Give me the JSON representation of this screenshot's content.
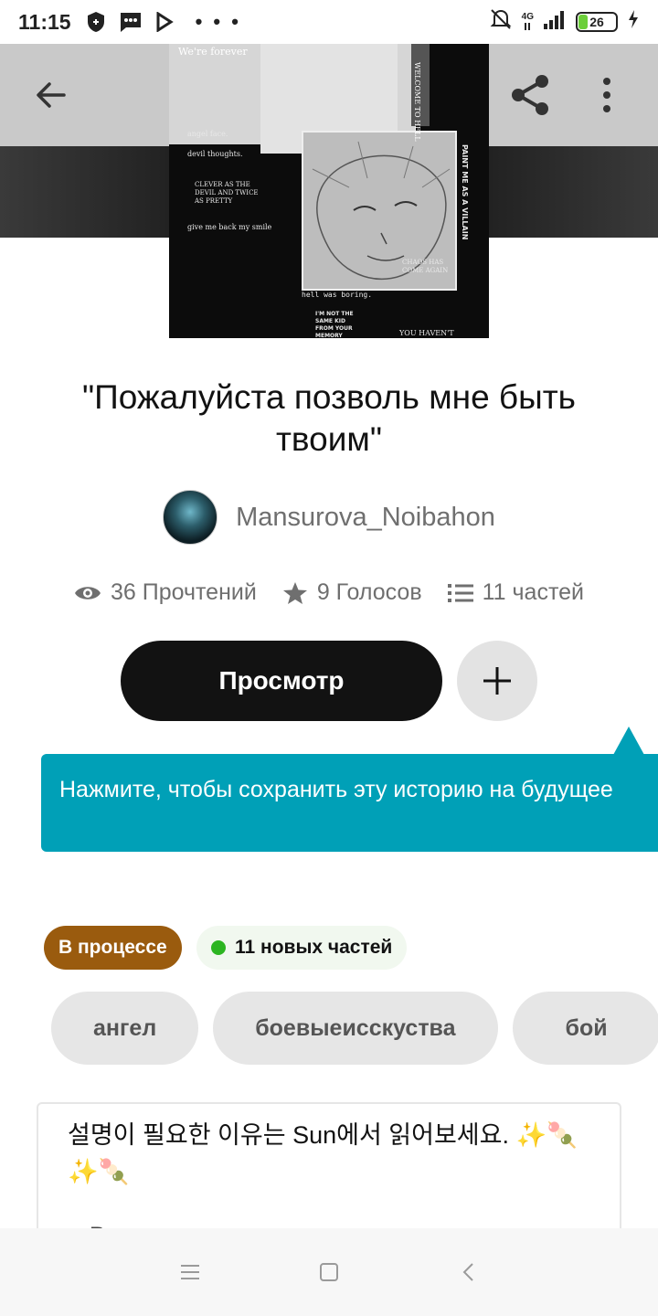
{
  "status_bar": {
    "time": "11:15",
    "network": "4G",
    "battery": "26",
    "battery_level": 0.26,
    "more_indicator": "• • •"
  },
  "toolbar": {
    "back_icon": "arrow-left-icon",
    "share_icon": "share-icon",
    "more_icon": "more-vertical-icon"
  },
  "story": {
    "title": "\"Пожалуйста позволь мне быть твоим\"",
    "author": "Mansurova_Noibahon",
    "reads": "36 Прочтений",
    "votes": "9 Голосов",
    "parts": "11 частей"
  },
  "cover_text": {
    "t1": "We're forever",
    "t2": "angel face.",
    "t3": "devil thoughts.",
    "t4": "CLEVER AS THE DEVIL AND TWICE AS PRETTY",
    "t5": "give me back my smile",
    "t6": "PAINT ME AS A VILLAIN",
    "t7": "CHAOS HAS COME AGAIN",
    "t8": "hell was boring.",
    "t9": "I'M NOT THE SAME KID FROM YOUR MEMORY",
    "t10": "YOU HAVEN'T",
    "t11": "WELCOME TO HELL"
  },
  "actions": {
    "read_label": "Просмотр",
    "add_icon": "plus-icon"
  },
  "tooltip": {
    "text": "Нажмите, чтобы сохранить эту историю на будущее"
  },
  "badges": {
    "status": "В процессе",
    "new_parts": "11 новых частей"
  },
  "tags": [
    "ангел",
    "боевыеисскуства",
    "бой"
  ],
  "description": {
    "line1": "설명이 필요한 이유는 Sun에서 읽어보세요. ✨🍡",
    "line2": "✨🍡",
    "more": "○ В"
  },
  "nav": {
    "menu_icon": "menu-icon",
    "home_icon": "square-icon",
    "back_icon": "chevron-left-icon"
  },
  "colors": {
    "primary": "#121212",
    "accent": "#00a0b7",
    "status_badge": "#9a5b0e",
    "new_dot": "#2cb521"
  }
}
